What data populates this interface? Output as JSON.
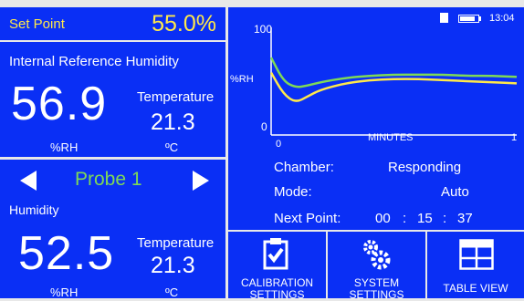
{
  "setpoint": {
    "label": "Set Point",
    "value": "55.0%"
  },
  "reference": {
    "title": "Internal Reference Humidity",
    "humidity_value": "56.9",
    "humidity_unit": "%RH",
    "temp_label": "Temperature",
    "temp_value": "21.3",
    "temp_unit": "ºC"
  },
  "probe": {
    "name": "Probe 1",
    "humidity_label": "Humidity",
    "humidity_value": "52.5",
    "humidity_unit": "%RH",
    "temp_label": "Temperature",
    "temp_value": "21.3",
    "temp_unit": "ºC"
  },
  "status": {
    "time": "13:04",
    "battery_level": 0.85,
    "colors": {
      "panel": "#0a2ff5",
      "yellow": "#ffe94a",
      "green": "#7ed957"
    }
  },
  "chart": {
    "y_max": "100",
    "y_min": "0",
    "y_unit": "%RH",
    "x_min": "0",
    "x_max": "1",
    "x_label": "MINUTES"
  },
  "info": {
    "chamber_label": "Chamber:",
    "chamber_value": "Responding",
    "mode_label": "Mode:",
    "mode_value": "Auto",
    "next_label": "Next Point:",
    "next_h": "00",
    "next_m": "15",
    "next_s": "37"
  },
  "buttons": {
    "calibration_line1": "CALIBRATION",
    "calibration_line2": "SETTINGS",
    "system_line1": "SYSTEM",
    "system_line2": "SETTINGS",
    "table": "TABLE VIEW"
  },
  "chart_data": {
    "type": "line",
    "x_range": [
      0,
      1
    ],
    "y_range": [
      0,
      100
    ],
    "series": [
      {
        "x": [
          0,
          0.05,
          0.1,
          0.15,
          0.2,
          0.3,
          0.4,
          0.5,
          0.6,
          0.7,
          0.8,
          0.9,
          1.0
        ],
        "values": [
          72,
          50,
          44,
          46,
          49,
          53,
          55,
          56,
          56,
          56,
          55,
          55,
          54
        ]
      },
      {
        "x": [
          0,
          0.05,
          0.1,
          0.15,
          0.2,
          0.3,
          0.4,
          0.5,
          0.6,
          0.7,
          0.8,
          0.9,
          1.0
        ],
        "values": [
          58,
          38,
          30,
          36,
          42,
          48,
          51,
          52,
          52,
          51,
          50,
          49,
          48
        ]
      }
    ]
  }
}
